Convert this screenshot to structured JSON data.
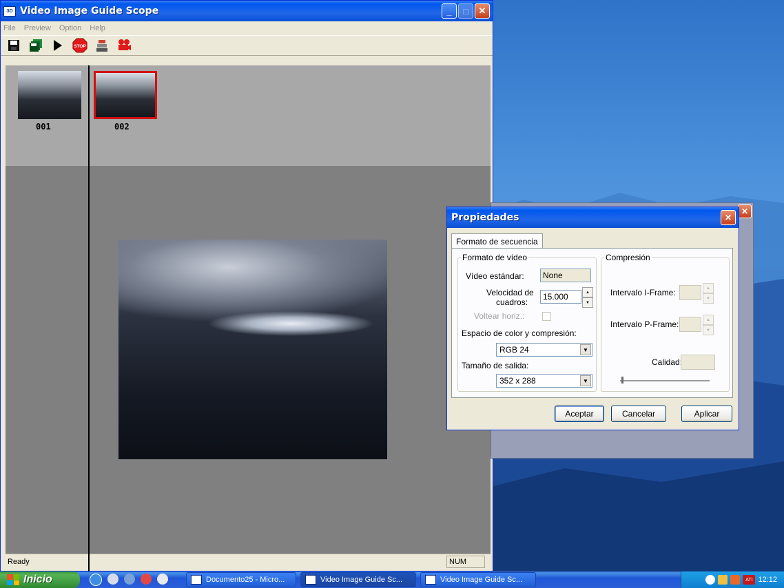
{
  "main_window": {
    "title": "Video Image Guide Scope",
    "app_icon_text": "ЗD",
    "menu": [
      "File",
      "Preview",
      "Option",
      "Help"
    ],
    "toolbar_icons": [
      "save-icon",
      "save-all-icon",
      "play-icon",
      "stop-icon",
      "capture-stack-icon",
      "camera-icon"
    ],
    "stop_text": "STOP",
    "thumbnails": [
      {
        "label": "001",
        "selected": false
      },
      {
        "label": "002",
        "selected": true
      }
    ],
    "status": {
      "text": "Ready",
      "num": "NUM"
    }
  },
  "dialog": {
    "title": "Propiedades",
    "tab": "Formato de secuencia",
    "video_group": {
      "legend": "Formato de vídeo",
      "standard_label": "Vídeo estándar:",
      "standard_value": "None",
      "fps_label_1": "Velocidad de",
      "fps_label_2": "cuadros:",
      "fps_value": "15.000",
      "flip_label": "Voltear horiz.:",
      "colorspace_label": "Espacio de color y compresión:",
      "colorspace_value": "RGB 24",
      "size_label": "Tamaño de salida:",
      "size_value": "352 x 288"
    },
    "compression_group": {
      "legend": "Compresión",
      "iframe_label": "Intervalo I-Frame:",
      "pframe_label": "Intervalo P-Frame:",
      "quality_label": "Calidad:"
    },
    "buttons": {
      "ok": "Aceptar",
      "cancel": "Cancelar",
      "apply": "Aplicar"
    }
  },
  "taskbar": {
    "start": "Inicio",
    "tasks": [
      {
        "label": "Documento25 - Micro...",
        "active": false
      },
      {
        "label": "Video Image Guide Sc...",
        "active": true
      },
      {
        "label": "Video Image Guide Sc...",
        "active": false
      }
    ],
    "tray_ati": "ATI",
    "clock": "12:12"
  }
}
